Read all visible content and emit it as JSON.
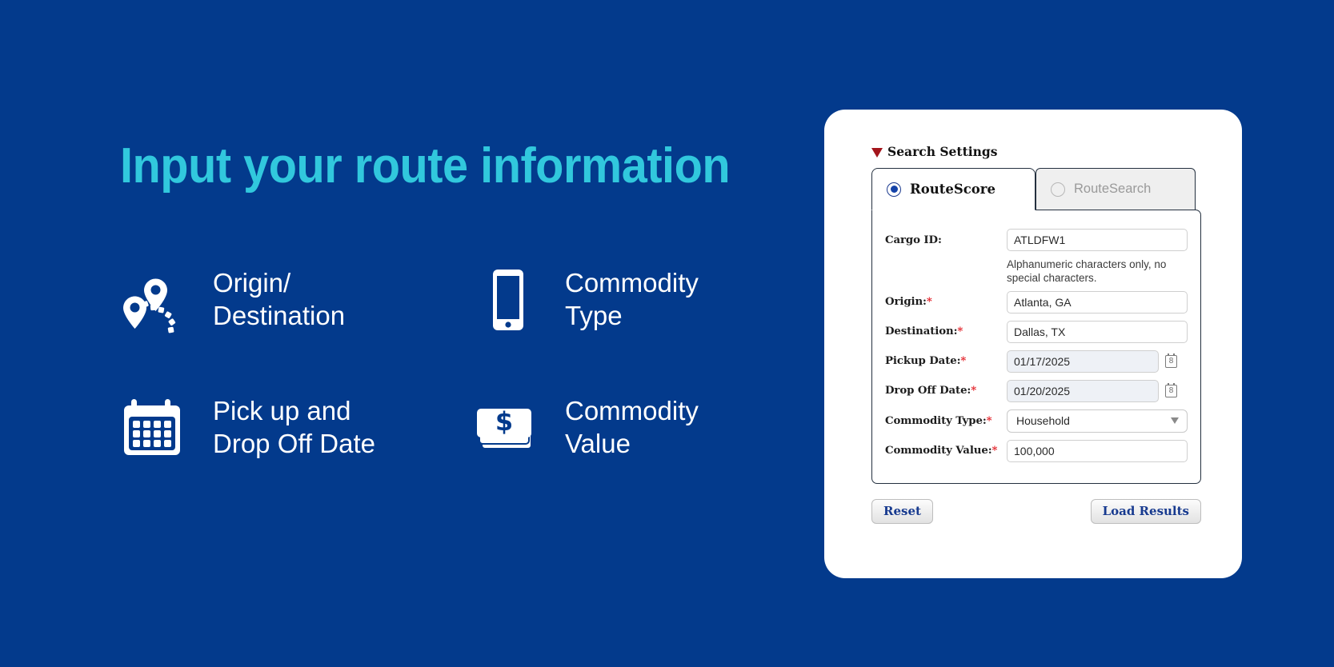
{
  "theme": {
    "background": "#033a8c",
    "heading_color": "#31c8dd",
    "card_background": "#ffffff",
    "required_color": "#e3242b",
    "button_text_color": "#173a8f"
  },
  "promo": {
    "heading": "Input your route information",
    "features": [
      {
        "icon": "route-pins-icon",
        "label": "Origin/\nDestination"
      },
      {
        "icon": "mobile-phone-icon",
        "label": "Commodity\nType"
      },
      {
        "icon": "calendar-icon",
        "label": "Pick up and\nDrop Off Date"
      },
      {
        "icon": "cash-dollar-icon",
        "label": "Commodity\nValue"
      }
    ]
  },
  "panel": {
    "section_title": "Search Settings",
    "section_icon": "red-triangle-icon",
    "tabs": [
      {
        "label": "RouteScore",
        "selected": true
      },
      {
        "label": "RouteSearch",
        "selected": false
      }
    ],
    "fields": {
      "cargo_id": {
        "label": "Cargo ID:",
        "required": false,
        "value": "ATLDFW1",
        "helper": "Alphanumeric characters only, no special characters."
      },
      "origin": {
        "label": "Origin:",
        "required": true,
        "value": "Atlanta, GA"
      },
      "destination": {
        "label": "Destination:",
        "required": true,
        "value": "Dallas, TX"
      },
      "pickup_date": {
        "label": "Pickup Date:",
        "required": true,
        "value": "01/17/2025",
        "icon": "calendar-picker-icon"
      },
      "dropoff_date": {
        "label": "Drop Off Date:",
        "required": true,
        "value": "01/20/2025",
        "icon": "calendar-picker-icon"
      },
      "commodity_type": {
        "label": "Commodity Type:",
        "required": true,
        "value": "Household",
        "icon": "chevron-down-icon"
      },
      "commodity_value": {
        "label": "Commodity Value:",
        "required": true,
        "value": "100,000"
      }
    },
    "buttons": {
      "reset": "Reset",
      "load_results": "Load Results"
    }
  }
}
